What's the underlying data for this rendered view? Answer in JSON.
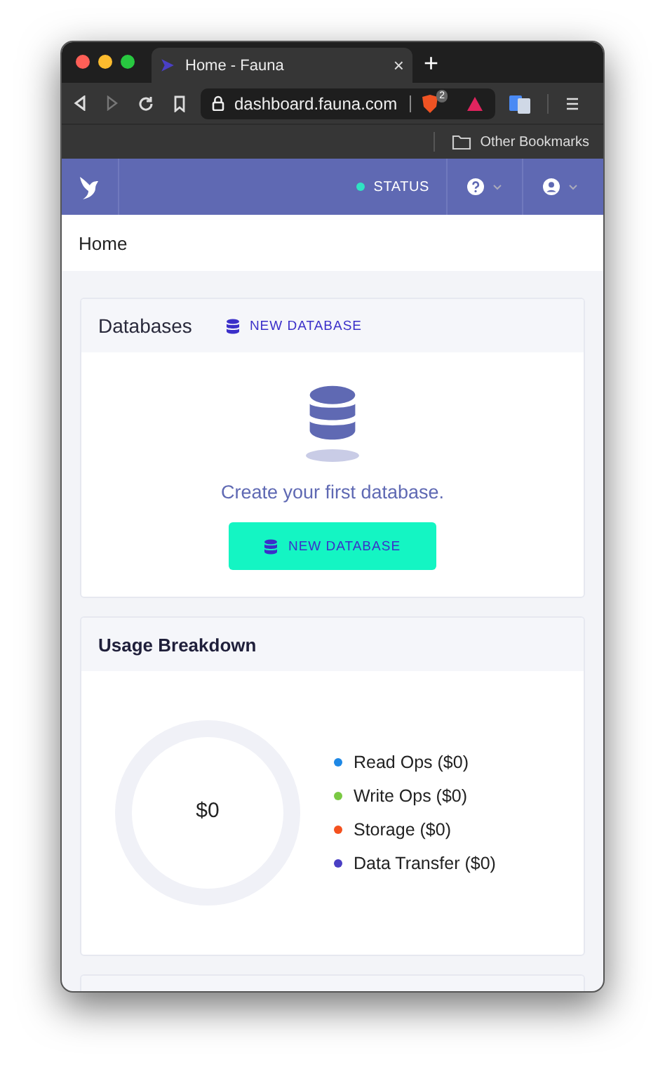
{
  "browser": {
    "tab": {
      "title": "Home - Fauna",
      "close": "×"
    },
    "new_tab": "+",
    "address": "dashboard.fauna.com",
    "extension_badge": "2",
    "bookmarks": [
      {
        "label": "Other Bookmarks"
      }
    ]
  },
  "header": {
    "status": "STATUS"
  },
  "breadcrumb": "Home",
  "databases": {
    "title": "Databases",
    "header_button": "NEW DATABASE",
    "empty_text": "Create your first database.",
    "button": "NEW DATABASE"
  },
  "usage": {
    "title": "Usage Breakdown",
    "total": "$0",
    "legend": [
      {
        "label": "Read Ops ($0)",
        "color": "#1e88e5"
      },
      {
        "label": "Write Ops ($0)",
        "color": "#7ac943"
      },
      {
        "label": "Storage ($0)",
        "color": "#f4511e"
      },
      {
        "label": "Data Transfer ($0)",
        "color": "#4a3fc4"
      }
    ]
  }
}
